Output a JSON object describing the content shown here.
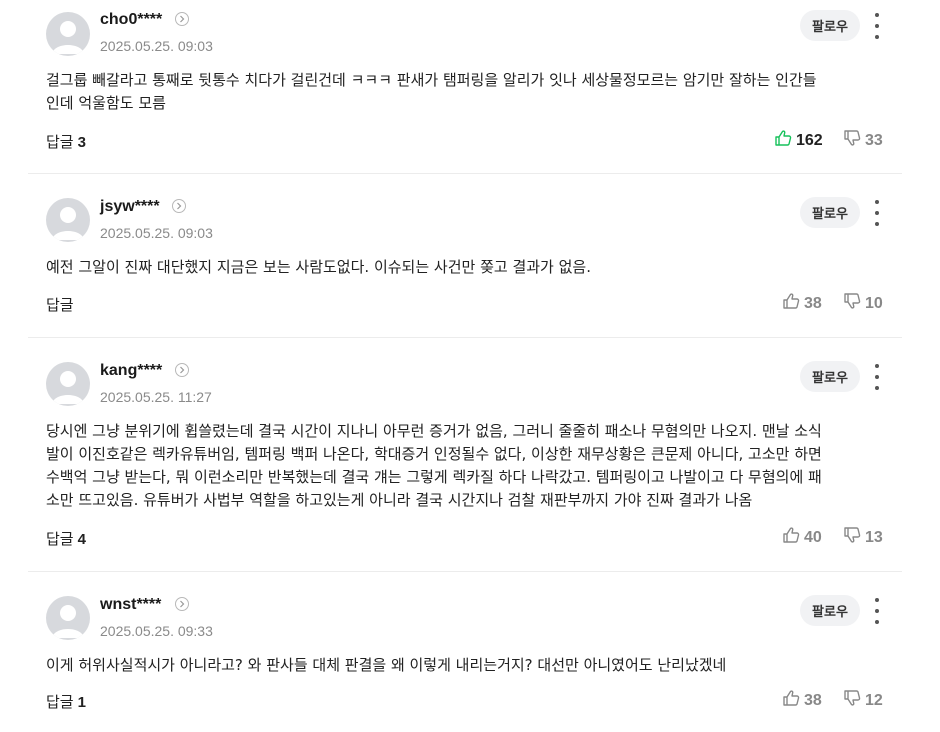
{
  "follow_label": "팔로우",
  "reply_label": "답글",
  "accent_like_color": "#16c15b",
  "comments": [
    {
      "nick": "cho0****",
      "date": "2025.05.25. 09:03",
      "text": "걸그룹 빼갈라고 통째로 뒷통수 치다가 걸린건데 ㅋㅋㅋ 판새가 탬퍼링을 알리가 잇나 세상물정모르는 암기만 잘하는 인간들\n인데 억울함도 모름",
      "reply_count": "3",
      "likes": "162",
      "dislikes": "33",
      "liked": true
    },
    {
      "nick": "jsyw****",
      "date": "2025.05.25. 09:03",
      "text": "예전 그알이 진짜 대단했지 지금은 보는 사람도없다. 이슈되는 사건만 쫒고 결과가 없음.",
      "reply_count": "",
      "likes": "38",
      "dislikes": "10",
      "liked": false
    },
    {
      "nick": "kang****",
      "date": "2025.05.25. 11:27",
      "text": "당시엔 그냥 분위기에 휩쓸렸는데 결국 시간이 지나니 아무런 증거가 없음, 그러니 줄줄히 패소나 무혐의만 나오지. 맨날 소식\n발이 이진호같은 렉카유튜버임, 템퍼링 백퍼 나온다, 학대증거 인정될수 없다, 이상한 재무상황은 큰문제 아니다, 고소만 하면\n수백억 그냥 받는다, 뭐 이런소리만 반복했는데 결국 걔는 그렇게 렉카질 하다 나락갔고. 템퍼링이고 나발이고 다 무혐의에 패\n소만 뜨고있음. 유튜버가 사법부 역할을 하고있는게 아니라 결국 시간지나 검찰 재판부까지 가야 진짜 결과가 나옴",
      "reply_count": "4",
      "likes": "40",
      "dislikes": "13",
      "liked": false
    },
    {
      "nick": "wnst****",
      "date": "2025.05.25. 09:33",
      "text": "이게 허위사실적시가 아니라고? 와 판사들 대체 판결을 왜 이렇게 내리는거지? 대선만 아니였어도 난리났겠네",
      "reply_count": "1",
      "likes": "38",
      "dislikes": "12",
      "liked": false
    }
  ]
}
